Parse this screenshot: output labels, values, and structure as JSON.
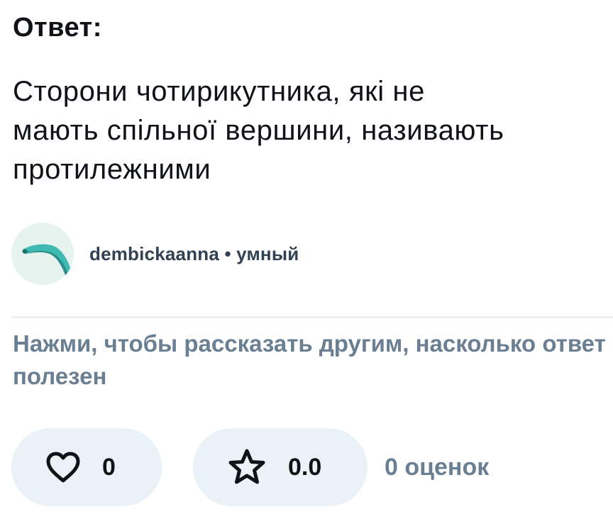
{
  "answer": {
    "heading": "Ответ:",
    "lines": [
      "Сторони чотирикутника, які не",
      "мають спільної вершини, називають",
      "протилежними"
    ]
  },
  "author": {
    "avatar_icon": "abstract-avatar-icon",
    "meta": "dembickaanna • умный"
  },
  "feedback": {
    "prompt_lines": [
      "Нажми, чтобы рассказать другим, насколько ответ",
      "полезен"
    ]
  },
  "rating": {
    "like_icon": "heart-icon",
    "likes": "0",
    "star_icon": "star-icon",
    "score": "0.0",
    "ratings_count": "0 оценок"
  },
  "colors": {
    "text": "#0f1318",
    "muted": "#6b7f93",
    "pill_bg": "#ebf2f7",
    "avatar_bg": "#e6f3ee",
    "avatar_accent": "#3fb9b1"
  }
}
